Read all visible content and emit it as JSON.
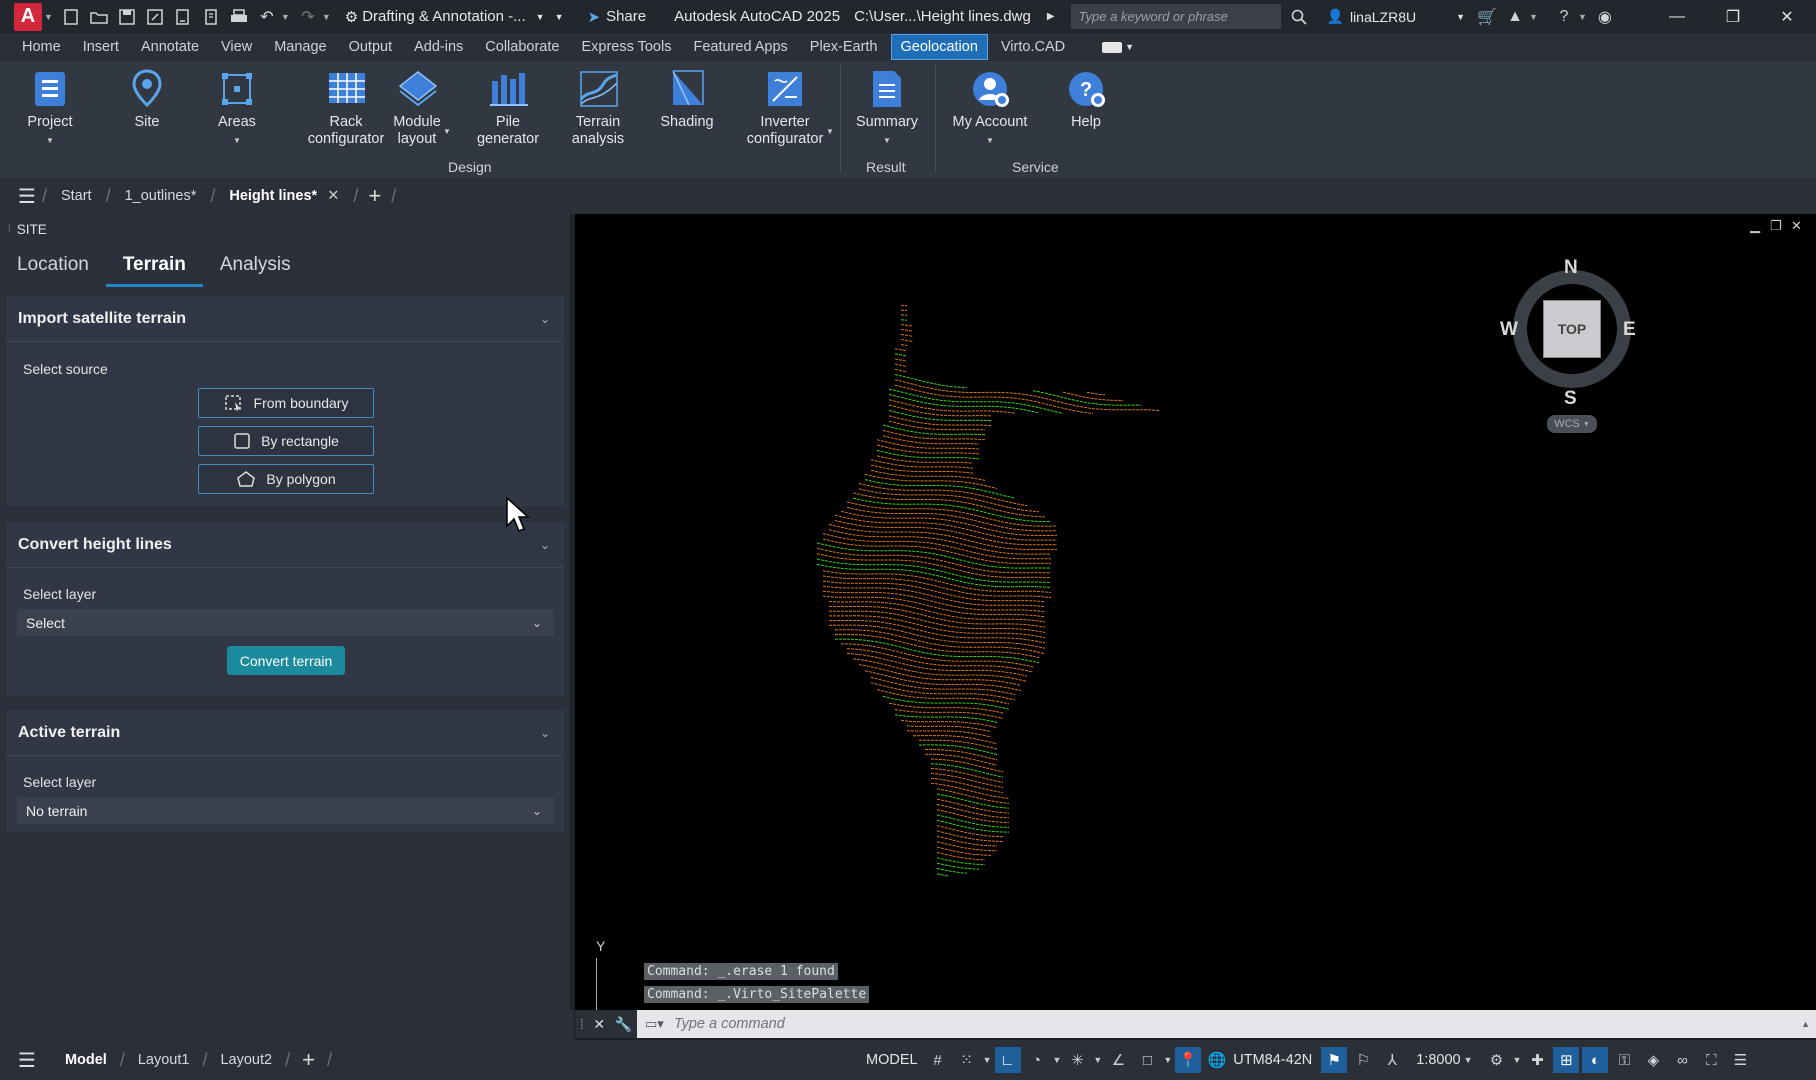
{
  "titlebar": {
    "app_logo": "A",
    "workspace": "Drafting & Annotation -...",
    "share_label": "Share",
    "app_title": "Autodesk AutoCAD 2025",
    "file_path": "C:\\User...\\Height lines.dwg",
    "search_placeholder": "Type a keyword or phrase",
    "username": "linaLZR8U"
  },
  "ribbon_tabs": [
    "Home",
    "Insert",
    "Annotate",
    "View",
    "Manage",
    "Output",
    "Add-ins",
    "Collaborate",
    "Express Tools",
    "Featured Apps",
    "Plex-Earth",
    "Geolocation",
    "Virto.CAD"
  ],
  "active_ribbon_tab": "Geolocation",
  "ribbon": {
    "project": "Project",
    "site": "Site",
    "areas": "Areas",
    "rack_1": "Rack",
    "rack_2": "configurator",
    "module_1": "Module",
    "module_2": "layout",
    "pile_1": "Pile",
    "pile_2": "generator",
    "terrain_1": "Terrain",
    "terrain_2": "analysis",
    "shading": "Shading",
    "inverter_1": "Inverter",
    "inverter_2": "configurator",
    "summary": "Summary",
    "my_account": "My Account",
    "help": "Help",
    "group_design": "Design",
    "group_result": "Result",
    "group_service": "Service"
  },
  "file_tabs": {
    "start": "Start",
    "outlines": "1_outlines*",
    "height_lines": "Height lines*"
  },
  "palette": {
    "title": "SITE",
    "tabs": [
      "Location",
      "Terrain",
      "Analysis"
    ],
    "active_tab": "Terrain",
    "import": {
      "title": "Import satellite terrain",
      "select_source": "Select source",
      "from_boundary": "From boundary",
      "by_rectangle": "By rectangle",
      "by_polygon": "By polygon"
    },
    "convert": {
      "title": "Convert height lines",
      "select_layer": "Select layer",
      "select_value": "Select",
      "convert_button": "Convert terrain"
    },
    "active": {
      "title": "Active terrain",
      "select_layer": "Select layer",
      "select_value": "No terrain"
    }
  },
  "viewcube": {
    "n": "N",
    "s": "S",
    "e": "E",
    "w": "W",
    "face": "TOP",
    "ucs": "WCS"
  },
  "ucs_axis": "Y",
  "command": {
    "history": [
      "Command: _.erase 1 found",
      "Command: _.Virto_SitePalette"
    ],
    "placeholder": "Type a command"
  },
  "statusbar": {
    "layouts": [
      "Model",
      "Layout1",
      "Layout2"
    ],
    "active_layout": "Model",
    "model": "MODEL",
    "coord_system": "UTM84-42N",
    "scale": "1:8000"
  },
  "colors": {
    "accent": "#1f6fb8",
    "convert_button": "#1a8a9c",
    "contour_orange": "#d9761f",
    "contour_green": "#3bd21c"
  }
}
